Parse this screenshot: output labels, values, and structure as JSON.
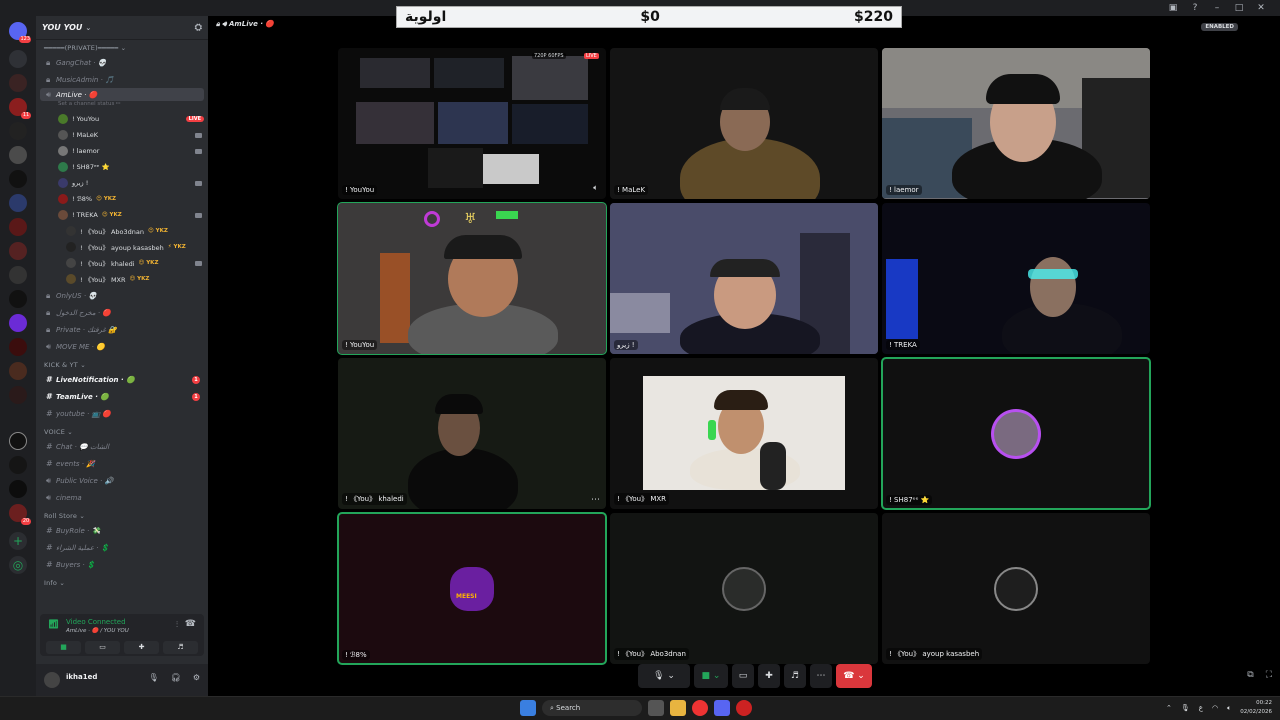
{
  "banner": {
    "left": "اولوية",
    "mid": "$0",
    "right": "$220"
  },
  "server": {
    "name": "YOU YOU",
    "caret": "⌄"
  },
  "categories": {
    "private": "━━━━━(PRIVATE)━━━━━ ⌄",
    "kick": "KICK & YT ⌄",
    "voice": "VOICE ⌄",
    "roll": "Roll Store ⌄",
    "info": "Info ⌄"
  },
  "channels_private": [
    {
      "icon": "#",
      "label": "GangChat · 💀"
    },
    {
      "icon": "#",
      "label": "MusicAdmin · 🎵"
    }
  ],
  "active_channel": {
    "icon": "🔊",
    "label": "AmLive · 🔴",
    "status": "Set a channel status ✏"
  },
  "voice_users": [
    {
      "name": "! YouYou",
      "tag": "",
      "badge": "LIVE"
    },
    {
      "name": "! MaLeK",
      "tag": ""
    },
    {
      "name": "! laemor",
      "tag": ""
    },
    {
      "name": "! SH87ᵉᵉ ⭐",
      "tag": ""
    },
    {
      "name": "زيرو !",
      "tag": ""
    },
    {
      "name": "! ℬ8%",
      "tag": "😍 YKZ"
    },
    {
      "name": "! TREKA",
      "tag": "😍 YKZ"
    },
    {
      "name": "! 《You》 Abo3dnan",
      "tag": "😍 YKZ"
    },
    {
      "name": "! 《You》 ayoup kasasbeh",
      "tag": "⚡ YKZ"
    },
    {
      "name": "! 《You》 khaledi",
      "tag": "😍 YKZ"
    },
    {
      "name": "! 《You》 MXR",
      "tag": "😍 YKZ"
    }
  ],
  "channels_after": [
    {
      "icon": "🔊",
      "label": "OnlyUS · 💀"
    },
    {
      "icon": "🔊",
      "label": "مخرج الدخول · 🔴"
    },
    {
      "icon": "🔊",
      "label": "Private · غرفتك 🔐"
    },
    {
      "icon": "🔊",
      "label": "MOVE ME · 🟡"
    }
  ],
  "channels_kick": [
    {
      "icon": "#",
      "label": "LiveNotification · 🟢",
      "badge": "1"
    },
    {
      "icon": "#",
      "label": "TeamLive · 🟢",
      "badge": "1"
    },
    {
      "icon": "#",
      "label": "youtube · 📺 🔴"
    }
  ],
  "channels_voice": [
    {
      "icon": "#",
      "label": "Chat · 💬 الشات"
    },
    {
      "icon": "#",
      "label": "events · 🎉"
    },
    {
      "icon": "🔊",
      "label": "Public Voice · 🔊"
    },
    {
      "icon": "🔊",
      "label": "cinema"
    }
  ],
  "channels_roll": [
    {
      "icon": "#",
      "label": "BuyRole · 💸"
    },
    {
      "icon": "#",
      "label": "عملية الشراء · 💲"
    },
    {
      "icon": "#",
      "label": "Buyers · 💲"
    }
  ],
  "voice_panel": {
    "status": "Video Connected",
    "channel": "AmLive · 🔴 / YOU YOU"
  },
  "me": {
    "name": "ikha1ed"
  },
  "call": {
    "title": "AmLive · 🔴",
    "enabled": "ENABLED"
  },
  "tiles": [
    {
      "label": "! YouYou",
      "kind": "screenshare",
      "stream_tag": "720P 60FPS",
      "live": "LIVE"
    },
    {
      "label": "! MaLeK",
      "kind": "video"
    },
    {
      "label": "! laemor",
      "kind": "video"
    },
    {
      "label": "! YouYou",
      "kind": "video",
      "speaking": true
    },
    {
      "label": "زيرو !",
      "kind": "video"
    },
    {
      "label": "! TREKA",
      "kind": "video"
    },
    {
      "label": "! 《You》 khaledi",
      "kind": "video"
    },
    {
      "label": "! 《You》 MXR",
      "kind": "video"
    },
    {
      "label": "! SH87ᵉᵉ ⭐",
      "kind": "avatar",
      "speaking": true
    },
    {
      "label": "! ℬ8%",
      "kind": "avatar",
      "speaking": true,
      "avatar_text": "MEESI"
    },
    {
      "label": "! 《You》 Abo3dnan",
      "kind": "avatar"
    },
    {
      "label": "! 《You》 ayoup kasasbeh",
      "kind": "avatar"
    }
  ],
  "taskbar": {
    "search": "Search",
    "time": "00:22",
    "date": "02/02/2026",
    "lang": "ع"
  },
  "colors": {
    "accent": "#23a55a",
    "danger": "#da373c",
    "blurple": "#5865f2"
  }
}
